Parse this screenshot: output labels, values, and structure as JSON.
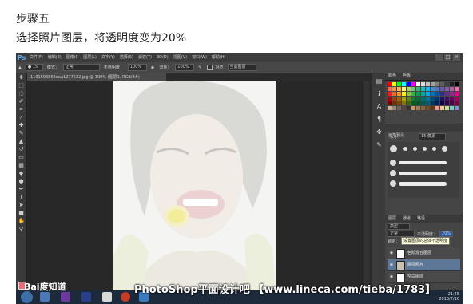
{
  "caption": {
    "step": "步骤五",
    "instruction": "选择照片图层，将透明度变为20%"
  },
  "photoshop": {
    "logo": "Ps",
    "menu": [
      "文件(F)",
      "编辑(E)",
      "图像(I)",
      "图层(L)",
      "文字(Y)",
      "选择(S)",
      "滤镜(T)",
      "3D(D)",
      "视图(V)",
      "窗口(W)",
      "帮助(H)"
    ],
    "window_controls": [
      "–",
      "□",
      "×"
    ],
    "options_bar": {
      "mode_label": "模式：",
      "mode_value": "正常",
      "opacity_label": "不透明度：",
      "opacity_value": "100%",
      "flow_label": "流量：",
      "flow_value": "100%",
      "sample_label": "对齐",
      "sample_value": "当前图层"
    },
    "document_tab": "1191596866eaa1277532.jpg @ 100% (图层1, RGB/8#)",
    "panel_tabs": {
      "color": [
        "颜色",
        "色板"
      ],
      "brush": [
        "画笔预设"
      ],
      "layers": [
        "图层",
        "通道",
        "路径"
      ]
    },
    "brush": {
      "size_label": "大小：",
      "size_value": "15 像素"
    },
    "layers": {
      "kind_label": "类型",
      "blend_mode": "正常",
      "opacity_label": "不透明度：",
      "opacity_value": "20%",
      "lock_label": "锁定：",
      "tooltip": "设置图层的总体不透明度",
      "items": [
        {
          "name": "色阶混合图层",
          "selected": false
        },
        {
          "name": "图层照片",
          "selected": true
        },
        {
          "name": "空白图层",
          "selected": false
        }
      ]
    },
    "taskbar": {
      "time": "21:45",
      "date": "2013/7/10"
    }
  },
  "watermark": {
    "baidu": "Bai度知道",
    "site": "PhotoShop平面设计吧 【www.lineca.com/tieba/1783】"
  }
}
